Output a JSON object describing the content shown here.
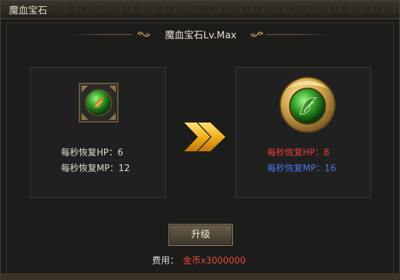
{
  "window": {
    "title": "魔血宝石"
  },
  "item": {
    "title": "魔血宝石Lv.Max"
  },
  "current": {
    "stats": [
      "每秒恢复HP：6",
      "每秒恢复MP：12"
    ]
  },
  "next": {
    "stats": [
      "每秒恢复HP：8",
      "每秒恢复MP：16"
    ]
  },
  "actions": {
    "upgrade_label": "升级"
  },
  "cost": {
    "label": "费用：",
    "value": "金币x3000000"
  },
  "colors": {
    "hp_next": "#e8403a",
    "mp_next": "#4a78e8",
    "stat_current": "#e0dccf",
    "cost_value": "#e84a3a",
    "arrow": "#f0b020",
    "gem_green": "#3ea82a",
    "gold_frame": "#c9a24a"
  },
  "icons": {
    "ornament": "scroll-ornament-icon",
    "arrow": "double-chevron-right-icon",
    "gem_current": "green-gem-square-icon",
    "gem_next": "green-gem-gold-medallion-icon"
  }
}
